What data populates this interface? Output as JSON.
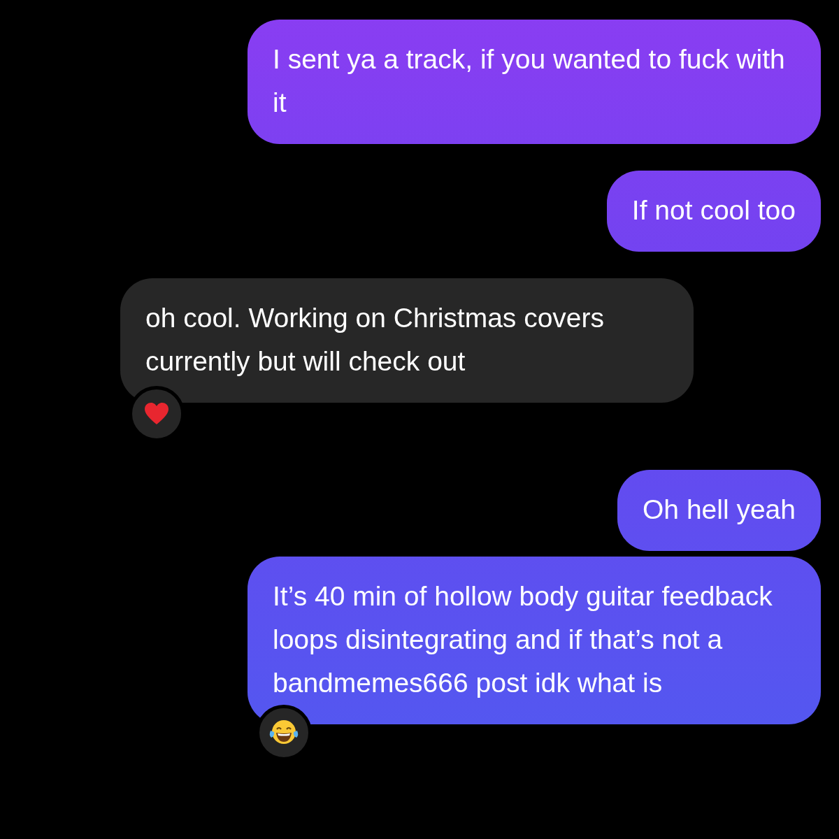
{
  "messages": [
    {
      "kind": "sent",
      "text": "I sent ya a track, if you wanted to fuck with it"
    },
    {
      "kind": "sent",
      "text": "If not cool too"
    },
    {
      "kind": "received",
      "text": "oh cool. Working on Christmas covers currently but will check out",
      "reaction": {
        "kind": "heart"
      }
    },
    {
      "kind": "sent",
      "text": "Oh hell yeah"
    },
    {
      "kind": "sent",
      "text": "It’s 40 min of hollow body guitar feedback loops disintegrating and if that’s not a bandmemes666 post idk what is",
      "reaction": {
        "kind": "laughing"
      }
    }
  ]
}
